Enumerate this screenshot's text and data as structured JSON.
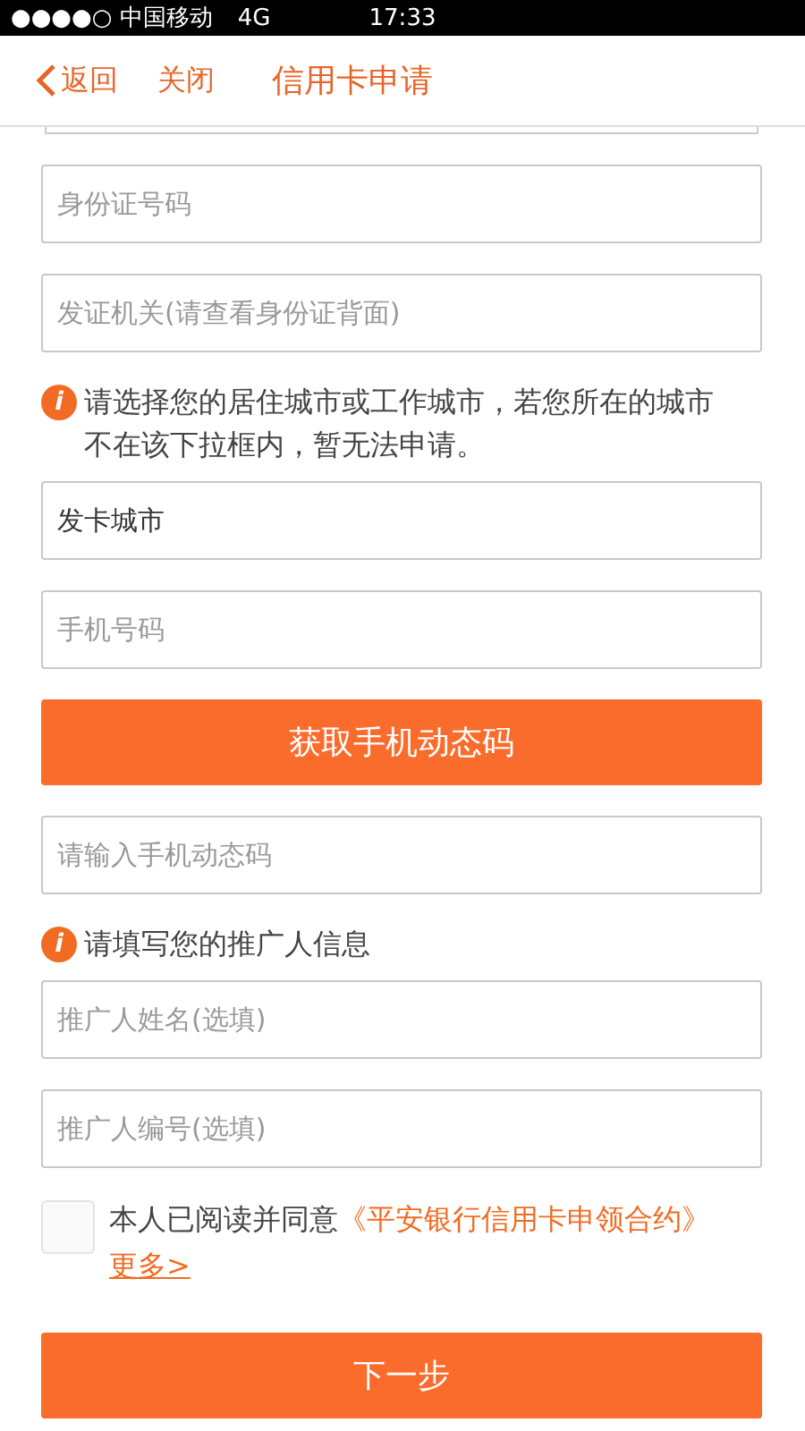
{
  "status_bar": {
    "carrier": "●●●●○ 中国移动",
    "network": "4G",
    "time": "17:33"
  },
  "nav": {
    "back": "返回",
    "close": "关闭",
    "title": "信用卡申请"
  },
  "form": [
    {
      "kind": "field",
      "placeholder": "身份证号码"
    },
    {
      "kind": "field",
      "placeholder": "发证机关(请查看身份证背面)"
    },
    {
      "kind": "notice",
      "icon": "i",
      "text": "请选择您的居住城市或工作城市，若您所在的城市不在该下拉框内，暂无法申请。"
    },
    {
      "kind": "field",
      "value": "发卡城市"
    },
    {
      "kind": "field",
      "placeholder": "手机号码"
    },
    {
      "kind": "button",
      "label": "获取手机动态码"
    },
    {
      "kind": "field",
      "placeholder": "请输入手机动态码"
    },
    {
      "kind": "notice",
      "icon": "i",
      "text": "请填写您的推广人信息"
    },
    {
      "kind": "field",
      "placeholder": "推广人姓名(选填)"
    },
    {
      "kind": "field",
      "placeholder": "推广人编号(选填)"
    }
  ],
  "agreement": {
    "checked": false,
    "text": "本人已阅读并同意",
    "link": "《平安银行信用卡申领合约》",
    "more": "更多>"
  },
  "next_button": "下一步"
}
